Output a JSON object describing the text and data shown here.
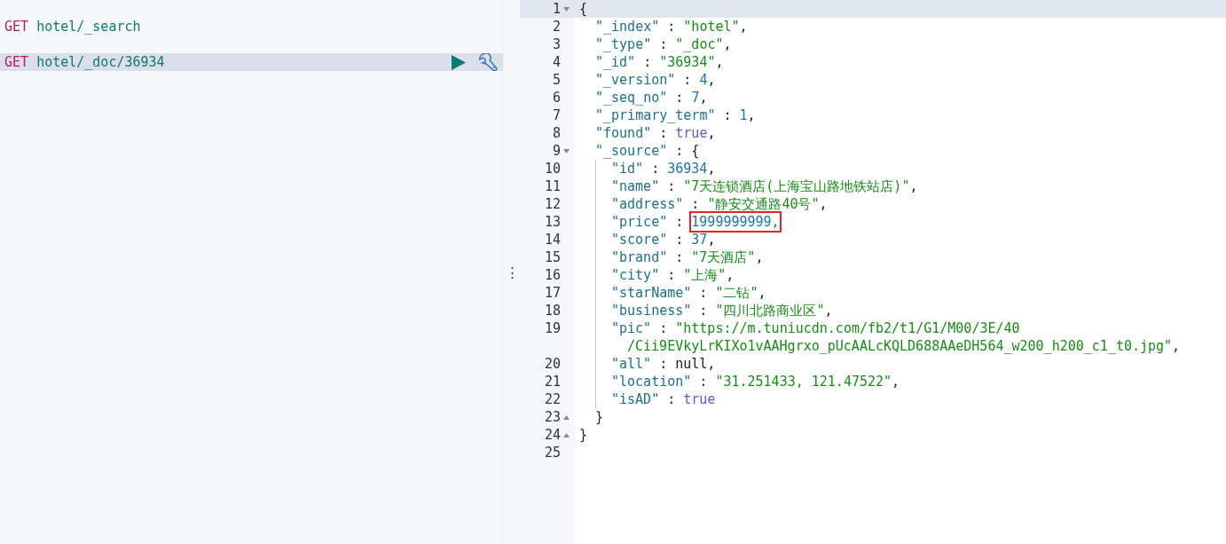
{
  "requests": [
    {
      "method": "GET",
      "path": "hotel/_search",
      "selected": false
    },
    {
      "method": "GET",
      "path": "hotel/_doc/36934",
      "selected": true
    }
  ],
  "response": {
    "root": {
      "number": "1",
      "active": true,
      "tokens": [
        {
          "kind": "punct",
          "text": "{"
        }
      ],
      "children": [
        {
          "number": "2",
          "active": false,
          "tokens": [
            {
              "kind": "key",
              "text": "\"_index\""
            },
            {
              "kind": "punct",
              "text": " : "
            },
            {
              "kind": "str",
              "text": "\"hotel\""
            },
            {
              "kind": "punct",
              "text": ","
            }
          ]
        },
        {
          "number": "3",
          "active": false,
          "tokens": [
            {
              "kind": "key",
              "text": "\"_type\""
            },
            {
              "kind": "punct",
              "text": " : "
            },
            {
              "kind": "str",
              "text": "\"_doc\""
            },
            {
              "kind": "punct",
              "text": ","
            }
          ]
        },
        {
          "number": "4",
          "active": false,
          "tokens": [
            {
              "kind": "key",
              "text": "\"_id\""
            },
            {
              "kind": "punct",
              "text": " : "
            },
            {
              "kind": "str",
              "text": "\"36934\""
            },
            {
              "kind": "punct",
              "text": ","
            }
          ]
        },
        {
          "number": "5",
          "active": false,
          "tokens": [
            {
              "kind": "key",
              "text": "\"_version\""
            },
            {
              "kind": "punct",
              "text": " : "
            },
            {
              "kind": "num",
              "text": "4"
            },
            {
              "kind": "punct",
              "text": ","
            }
          ]
        },
        {
          "number": "6",
          "active": false,
          "tokens": [
            {
              "kind": "key",
              "text": "\"_seq_no\""
            },
            {
              "kind": "punct",
              "text": " : "
            },
            {
              "kind": "num",
              "text": "7"
            },
            {
              "kind": "punct",
              "text": ","
            }
          ]
        },
        {
          "number": "7",
          "active": false,
          "tokens": [
            {
              "kind": "key",
              "text": "\"_primary_term\""
            },
            {
              "kind": "punct",
              "text": " : "
            },
            {
              "kind": "num",
              "text": "1"
            },
            {
              "kind": "punct",
              "text": ","
            }
          ]
        },
        {
          "number": "8",
          "active": false,
          "tokens": [
            {
              "kind": "key",
              "text": "\"found\""
            },
            {
              "kind": "punct",
              "text": " : "
            },
            {
              "kind": "bool",
              "text": "true"
            },
            {
              "kind": "punct",
              "text": ","
            }
          ]
        },
        {
          "number": "9",
          "active": false,
          "tokens": [
            {
              "kind": "key",
              "text": "\"_source\""
            },
            {
              "kind": "punct",
              "text": " : {"
            }
          ],
          "children": [
            {
              "number": "10",
              "active": false,
              "tokens": [
                {
                  "kind": "key",
                  "text": "\"id\""
                },
                {
                  "kind": "punct",
                  "text": " : "
                },
                {
                  "kind": "num",
                  "text": "36934"
                },
                {
                  "kind": "punct",
                  "text": ","
                }
              ]
            },
            {
              "number": "11",
              "active": false,
              "tokens": [
                {
                  "kind": "key",
                  "text": "\"name\""
                },
                {
                  "kind": "punct",
                  "text": " : "
                },
                {
                  "kind": "str",
                  "text": "\"7天连锁酒店(上海宝山路地铁站店)\""
                },
                {
                  "kind": "punct",
                  "text": ","
                }
              ]
            },
            {
              "number": "12",
              "active": false,
              "tokens": [
                {
                  "kind": "key",
                  "text": "\"address\""
                },
                {
                  "kind": "punct",
                  "text": " : "
                },
                {
                  "kind": "str",
                  "text": "\"静安交通路40号\""
                },
                {
                  "kind": "punct",
                  "text": ","
                }
              ]
            },
            {
              "number": "13",
              "active": false,
              "tokens": [
                {
                  "kind": "key",
                  "text": "\"price\""
                },
                {
                  "kind": "punct",
                  "text": " : "
                },
                {
                  "kind": "num",
                  "text": "1999999999,",
                  "highlighted": true
                }
              ]
            },
            {
              "number": "14",
              "active": false,
              "tokens": [
                {
                  "kind": "key",
                  "text": "\"score\""
                },
                {
                  "kind": "punct",
                  "text": " : "
                },
                {
                  "kind": "num",
                  "text": "37"
                },
                {
                  "kind": "punct",
                  "text": ","
                }
              ]
            },
            {
              "number": "15",
              "active": false,
              "tokens": [
                {
                  "kind": "key",
                  "text": "\"brand\""
                },
                {
                  "kind": "punct",
                  "text": " : "
                },
                {
                  "kind": "str",
                  "text": "\"7天酒店\""
                },
                {
                  "kind": "punct",
                  "text": ","
                }
              ]
            },
            {
              "number": "16",
              "active": false,
              "tokens": [
                {
                  "kind": "key",
                  "text": "\"city\""
                },
                {
                  "kind": "punct",
                  "text": " : "
                },
                {
                  "kind": "str",
                  "text": "\"上海\""
                },
                {
                  "kind": "punct",
                  "text": ","
                }
              ]
            },
            {
              "number": "17",
              "active": false,
              "tokens": [
                {
                  "kind": "key",
                  "text": "\"starName\""
                },
                {
                  "kind": "punct",
                  "text": " : "
                },
                {
                  "kind": "str",
                  "text": "\"二钻\""
                },
                {
                  "kind": "punct",
                  "text": ","
                }
              ]
            },
            {
              "number": "18",
              "active": false,
              "tokens": [
                {
                  "kind": "key",
                  "text": "\"business\""
                },
                {
                  "kind": "punct",
                  "text": " : "
                },
                {
                  "kind": "str",
                  "text": "\"四川北路商业区\""
                },
                {
                  "kind": "punct",
                  "text": ","
                }
              ]
            },
            {
              "number": "19",
              "active": false,
              "tokens": [
                {
                  "kind": "key",
                  "text": "\"pic\""
                },
                {
                  "kind": "punct",
                  "text": " : "
                },
                {
                  "kind": "str",
                  "text": "\"https://m.tuniucdn.com/fb2/t1/G1/M00/3E/40"
                }
              ],
              "wrapped_tokens": [
                {
                  "kind": "str",
                  "text": "/Cii9EVkyLrKIXo1vAAHgrxo_pUcAALcKQLD688AAeDH564_w200_h200_c1_t0.jpg\""
                },
                {
                  "kind": "punct",
                  "text": ","
                }
              ]
            },
            {
              "number": "20",
              "active": false,
              "tokens": [
                {
                  "kind": "key",
                  "text": "\"all\""
                },
                {
                  "kind": "punct",
                  "text": " : null,"
                }
              ]
            },
            {
              "number": "21",
              "active": false,
              "tokens": [
                {
                  "kind": "key",
                  "text": "\"location\""
                },
                {
                  "kind": "punct",
                  "text": " : "
                },
                {
                  "kind": "str",
                  "text": "\"31.251433, 121.47522\""
                },
                {
                  "kind": "punct",
                  "text": ","
                }
              ]
            },
            {
              "number": "22",
              "active": false,
              "tokens": [
                {
                  "kind": "key",
                  "text": "\"isAD\""
                },
                {
                  "kind": "punct",
                  "text": " : "
                },
                {
                  "kind": "bool",
                  "text": "true"
                }
              ]
            }
          ],
          "close": {
            "number": "23",
            "active": false,
            "tokens": [
              {
                "kind": "punct",
                "text": "}"
              }
            ]
          }
        }
      ],
      "close": {
        "number": "24",
        "active": false,
        "tokens": [
          {
            "kind": "punct",
            "text": "}"
          }
        ]
      }
    },
    "trailing": [
      {
        "number": "25",
        "active": false
      }
    ]
  },
  "splitter": {
    "handle": "⋮"
  }
}
